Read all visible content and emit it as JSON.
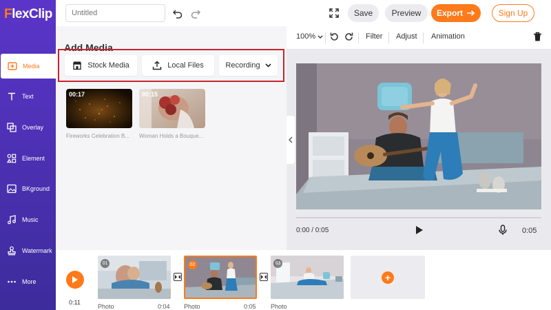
{
  "app": {
    "logo_prefix": "F",
    "logo_rest": "lexClip"
  },
  "sidebar": {
    "items": [
      {
        "label": "Media",
        "icon": "media-icon"
      },
      {
        "label": "Text",
        "icon": "text-icon"
      },
      {
        "label": "Overlay",
        "icon": "overlay-icon"
      },
      {
        "label": "Element",
        "icon": "element-icon"
      },
      {
        "label": "BKground",
        "icon": "background-icon"
      },
      {
        "label": "Music",
        "icon": "music-icon"
      },
      {
        "label": "Watermark",
        "icon": "watermark-icon"
      },
      {
        "label": "More",
        "icon": "more-icon"
      }
    ]
  },
  "topbar": {
    "title_placeholder": "Untitled",
    "save_label": "Save",
    "preview_label": "Preview",
    "export_label": "Export",
    "signup_label": "Sign Up"
  },
  "media_panel": {
    "title": "Add Media",
    "sources": [
      {
        "label": "Stock Media",
        "icon": "store-icon"
      },
      {
        "label": "Local Files",
        "icon": "upload-icon"
      },
      {
        "label": "Recording",
        "icon": "chevron-down-icon"
      }
    ],
    "items": [
      {
        "duration": "00:17",
        "caption": "Fireworks Celebration B..."
      },
      {
        "duration": "00:15",
        "caption": "Woman Holds a Bouque..."
      }
    ]
  },
  "preview": {
    "zoom": "100%",
    "tools": [
      "Filter",
      "Adjust",
      "Animation"
    ],
    "time": "0:00 / 0:05",
    "duration": "0:05"
  },
  "timeline": {
    "current_time": "0:11",
    "clips": [
      {
        "num": "01",
        "label": "Photo",
        "duration": "0:04"
      },
      {
        "num": "02",
        "label": "Photo",
        "duration": "0:05"
      },
      {
        "num": "03",
        "label": "Photo",
        "duration": ""
      }
    ]
  },
  "colors": {
    "accent": "#ff7a1a",
    "sidebar": "#4a30b5",
    "highlight": "#c8232c"
  }
}
